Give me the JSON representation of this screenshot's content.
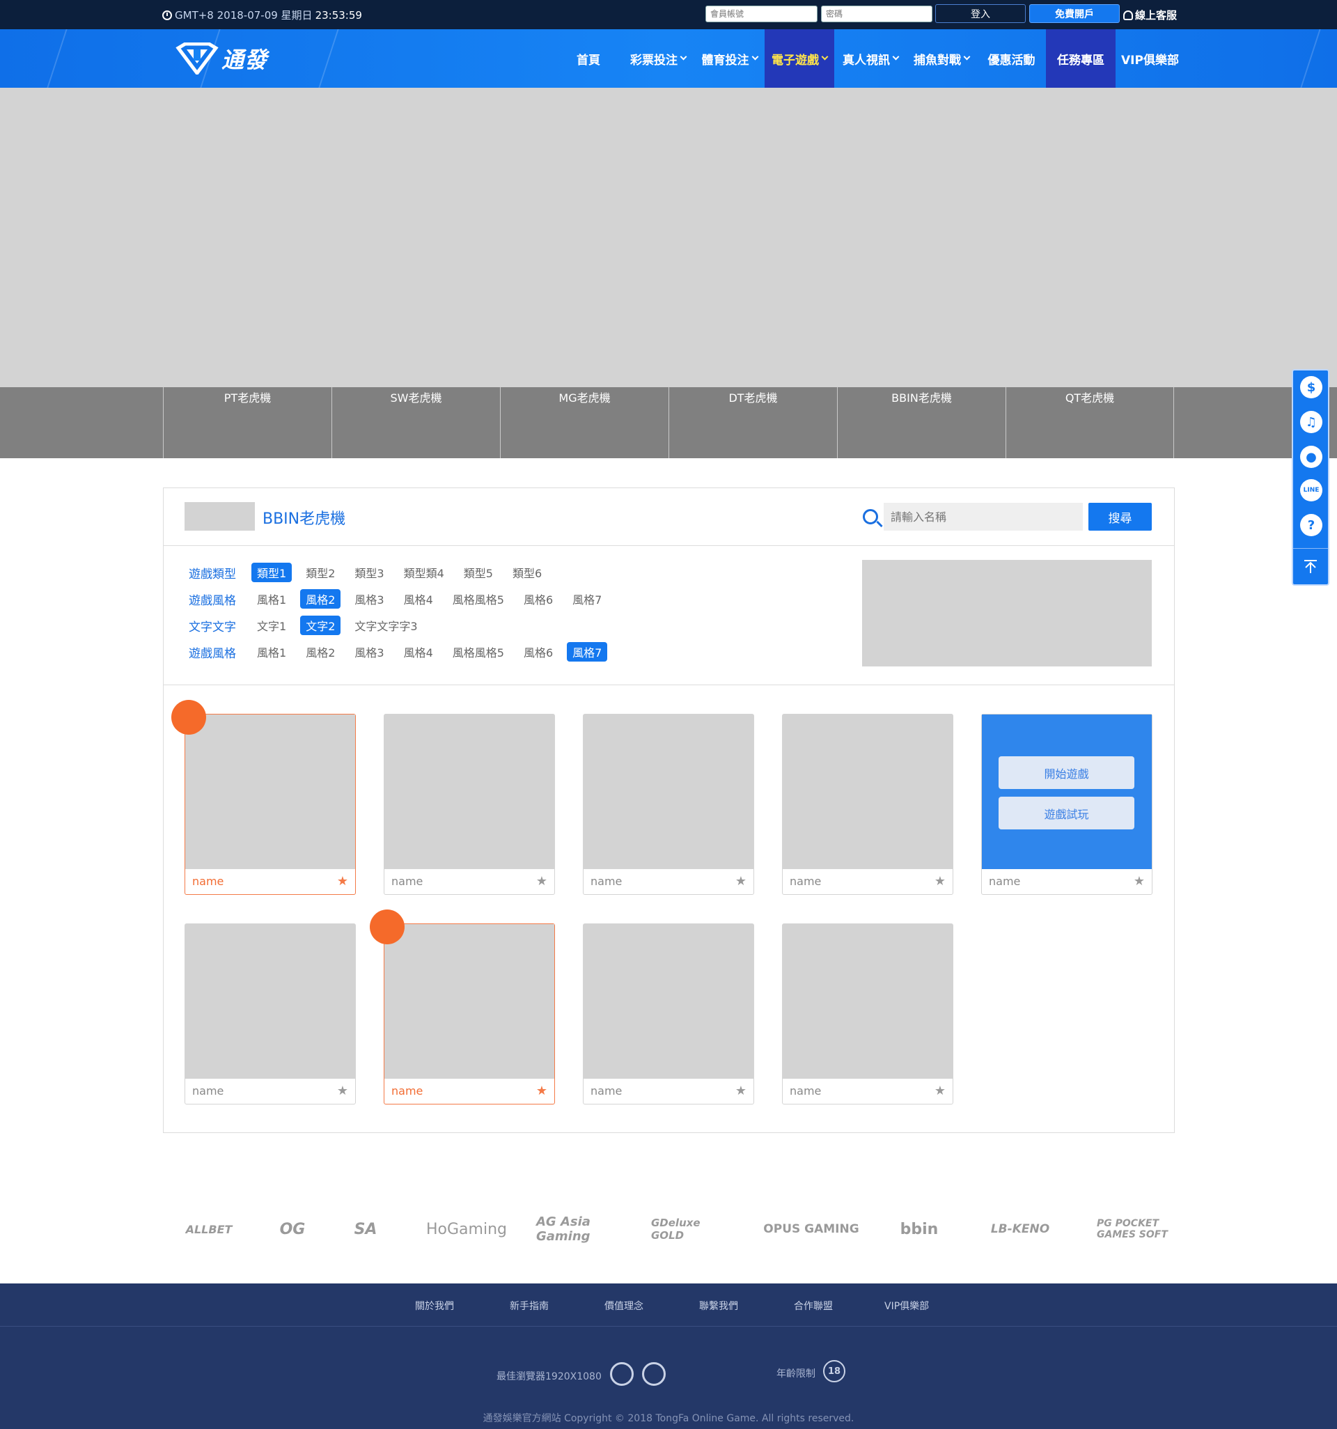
{
  "topbar": {
    "date": "GMT+8 2018-07-09 星期日",
    "time": "23:53:59",
    "account_placeholder": "會員帳號",
    "password_placeholder": "密碼",
    "login_label": "登入",
    "register_label": "免費開戶",
    "support_label": "線上客服"
  },
  "logo": {
    "text": "通發"
  },
  "nav": [
    {
      "label": "首頁",
      "dropdown": false
    },
    {
      "label": "彩票投注",
      "dropdown": true
    },
    {
      "label": "體育投注",
      "dropdown": true
    },
    {
      "label": "電子遊戲",
      "dropdown": true,
      "active": true
    },
    {
      "label": "真人視訊",
      "dropdown": true
    },
    {
      "label": "捕魚對戰",
      "dropdown": true
    },
    {
      "label": "優惠活動",
      "dropdown": false
    },
    {
      "label": "任務專區",
      "dropdown": false
    },
    {
      "label": "VIP俱樂部",
      "dropdown": false
    }
  ],
  "providers": [
    "PT老虎機",
    "SW老虎機",
    "MG老虎機",
    "DT老虎機",
    "BBIN老虎機",
    "QT老虎機"
  ],
  "panel": {
    "title": "BBIN老虎機",
    "search_placeholder": "請輸入名稱",
    "search_label": "搜尋"
  },
  "filters": [
    {
      "label": "遊戲類型",
      "options": [
        "類型1",
        "類型2",
        "類型3",
        "類型類4",
        "類型5",
        "類型6"
      ],
      "selected": 0
    },
    {
      "label": "遊戲風格",
      "options": [
        "風格1",
        "風格2",
        "風格3",
        "風格4",
        "風格風格5",
        "風格6",
        "風格7"
      ],
      "selected": 1
    },
    {
      "label": "文字文字",
      "options": [
        "文字1",
        "文字2",
        "文字文字字3"
      ],
      "selected": 1
    },
    {
      "label": "遊戲風格",
      "options": [
        "風格1",
        "風格2",
        "風格3",
        "風格4",
        "風格風格5",
        "風格6",
        "風格7"
      ],
      "selected": 6
    }
  ],
  "games": [
    {
      "name": "name",
      "highlighted": true,
      "hot": true
    },
    {
      "name": "name",
      "highlighted": false,
      "hot": false
    },
    {
      "name": "name",
      "highlighted": false,
      "hot": false
    },
    {
      "name": "name",
      "highlighted": false,
      "hot": false
    },
    {
      "name": "name",
      "highlighted": false,
      "hot": false,
      "hover": true
    },
    {
      "name": "name",
      "highlighted": false,
      "hot": false
    },
    {
      "name": "name",
      "highlighted": true,
      "hot": true
    },
    {
      "name": "name",
      "highlighted": false,
      "hot": false
    },
    {
      "name": "name",
      "highlighted": false,
      "hot": false
    }
  ],
  "game_overlay": {
    "play_label": "開始遊戲",
    "trial_label": "遊戲試玩"
  },
  "sidebar": {
    "icons": [
      "dollar-icon",
      "headset-icon",
      "wechat-icon",
      "line-icon",
      "help-icon",
      "back-to-top-icon"
    ]
  },
  "partners": [
    "ALLBET",
    "OG",
    "SA",
    "HoGaming",
    "AG Asia Gaming",
    "GDeluxe GOLD",
    "OPUS GAMING",
    "bbin",
    "LB-KENO",
    "PG POCKET GAMES SOFT"
  ],
  "footer": {
    "links": [
      "關於我們",
      "新手指南",
      "價值理念",
      "聯繫我們",
      "合作聯盟",
      "VIP俱樂部"
    ],
    "browser_note": "最佳瀏覽器1920X1080",
    "age_note": "年齡限制",
    "age_badge": "18",
    "copyright": "通發娛樂官方網站 Copyright © 2018 TongFa Online Game. All rights reserved."
  },
  "colors": {
    "primary": "#1478ef",
    "nav_active": "#2338b8",
    "nav_active_text": "#ffe44a",
    "highlight": "#f56a2a",
    "footer": "#243868"
  }
}
